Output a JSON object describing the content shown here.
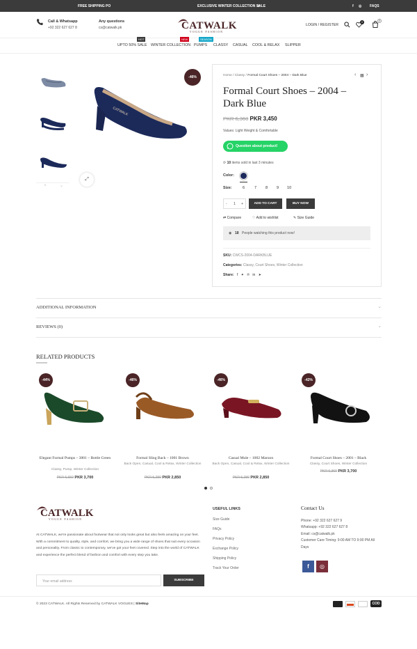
{
  "topbar": {
    "left_text": "FREE SHIPPING PO",
    "center_text": "EXCLUSIVE WINTER COLLECTION SALE",
    "faqs": "FAQS"
  },
  "header": {
    "call_title": "Call & Whatsapp",
    "call_number": "+92 322 627 627 8",
    "questions_title": "Any questions",
    "questions_email": "cs@catwalk.pk",
    "logo": "CATWALK",
    "logo_tag": "VOGUE FASHION",
    "login": "LOGIN / REGISTER",
    "wishlist_count": "0",
    "cart_count": "0"
  },
  "nav": {
    "items": [
      "UPTO 50% SALE",
      "WINTER COLLECTION",
      "PUMPS",
      "CLASSY",
      "CASUAL",
      "COOL & RELAX",
      "SLIPPER"
    ],
    "badges": [
      "HOT",
      "NEW",
      "SEASON"
    ]
  },
  "gallery": {
    "discount": "-46%"
  },
  "product": {
    "breadcrumb_home": "Home",
    "breadcrumb_cat": "Classy",
    "breadcrumb_current": "Formal Court Shoes – 2004 – Dark Blue",
    "title": "Formal Court Shoes – 2004 – Dark Blue",
    "old_price": "PKR 6,360",
    "price": "PKR  3,450",
    "values": "Values: Light Weight & Comfortable",
    "whatsapp": "Question about product!",
    "sold_count": "10",
    "sold_text": "items sold in last 3 minutes",
    "color_label": "Color:",
    "size_label": "Size:",
    "sizes": [
      "6",
      "7",
      "8",
      "9",
      "10"
    ],
    "qty_minus": "-",
    "qty": "1",
    "qty_plus": "+",
    "add_to_cart": "ADD TO CART",
    "buy_now": "BUY NOW",
    "compare": "Compare",
    "wishlist": "Add to wishlist",
    "size_guide": "Size Guide",
    "watching_count": "18",
    "watching_text": "People watching this product now!",
    "sku_label": "SKU:",
    "sku": "CWCS-2004-DARKBLUE",
    "categories_label": "Categories:",
    "categories": "Classy, Court Shoes, Winter Collection",
    "share_label": "Share:"
  },
  "accordion": {
    "additional": "ADDITIONAL INFORMATION",
    "reviews": "REVIEWS (0)"
  },
  "related": {
    "title": "RELATED PRODUCTS",
    "items": [
      {
        "discount": "-44%",
        "title": "Elegant Formal Pumps – 3001 – Bottle Green",
        "cats": "Classy, Pump, Winter Collection",
        "old": "PKR 6,650",
        "price": "PKR  3,700"
      },
      {
        "discount": "-46%",
        "title": "Formal Sling Back – 1001 Brown",
        "cats": "Back Open, Casual, Cool & Relax, Winter Collection",
        "old": "PKR 5,280",
        "price": "PKR  2,850"
      },
      {
        "discount": "-46%",
        "title": "Casual Mule – 1002 Maroon",
        "cats": "Back Open, Casual, Cool & Relax, Winter Collection",
        "old": "PKR 5,280",
        "price": "PKR  2,850"
      },
      {
        "discount": "-42%",
        "title": "Formal Court Shoes – 2001 – Black",
        "cats": "Classy, Court Shoes, Winter Collection",
        "old": "PKR 6,360",
        "price": "PKR  3,700"
      }
    ]
  },
  "footer": {
    "about": "At CATWALK, we're passionate about footwear that not only looks great but also feels amazing on your feet. With a commitment to quality, style, and comfort, we bring you a wide range of shoes that suit every occasion and personality. From classic to contemporary, we've got your feet covered. Step into the world of CATWALK and experience the perfect blend of fashion and comfort with every step you take.",
    "email_placeholder": "Your email address",
    "subscribe": "SUBSCRIBE",
    "links_title": "USEFUL LINKS",
    "links": [
      "Size Guide",
      "FAQs",
      "Privacy Policy",
      "Exchange Policy",
      "Shipping Policy",
      "Track Your Order"
    ],
    "contact_title": "Contact Us",
    "phone": "Phone: +92 322 627 627 9",
    "whatsapp": "Whatsapp: +92 322 627 627 8",
    "email": "Email: cs@catwalk.pk",
    "timing": "Customer Care Timing: 9:00 AM TO 9:00 PM All Days",
    "copyright": "© 2023 CATWALK. All Rights Reserved by CATWALK VOGUES |",
    "sitemap": "SiteMap",
    "cod": "COD"
  },
  "colors": {
    "brand": "#4a2426",
    "dark": "#3b3b3b",
    "whatsapp": "#25d366",
    "swatch": "#1d2a5c"
  }
}
